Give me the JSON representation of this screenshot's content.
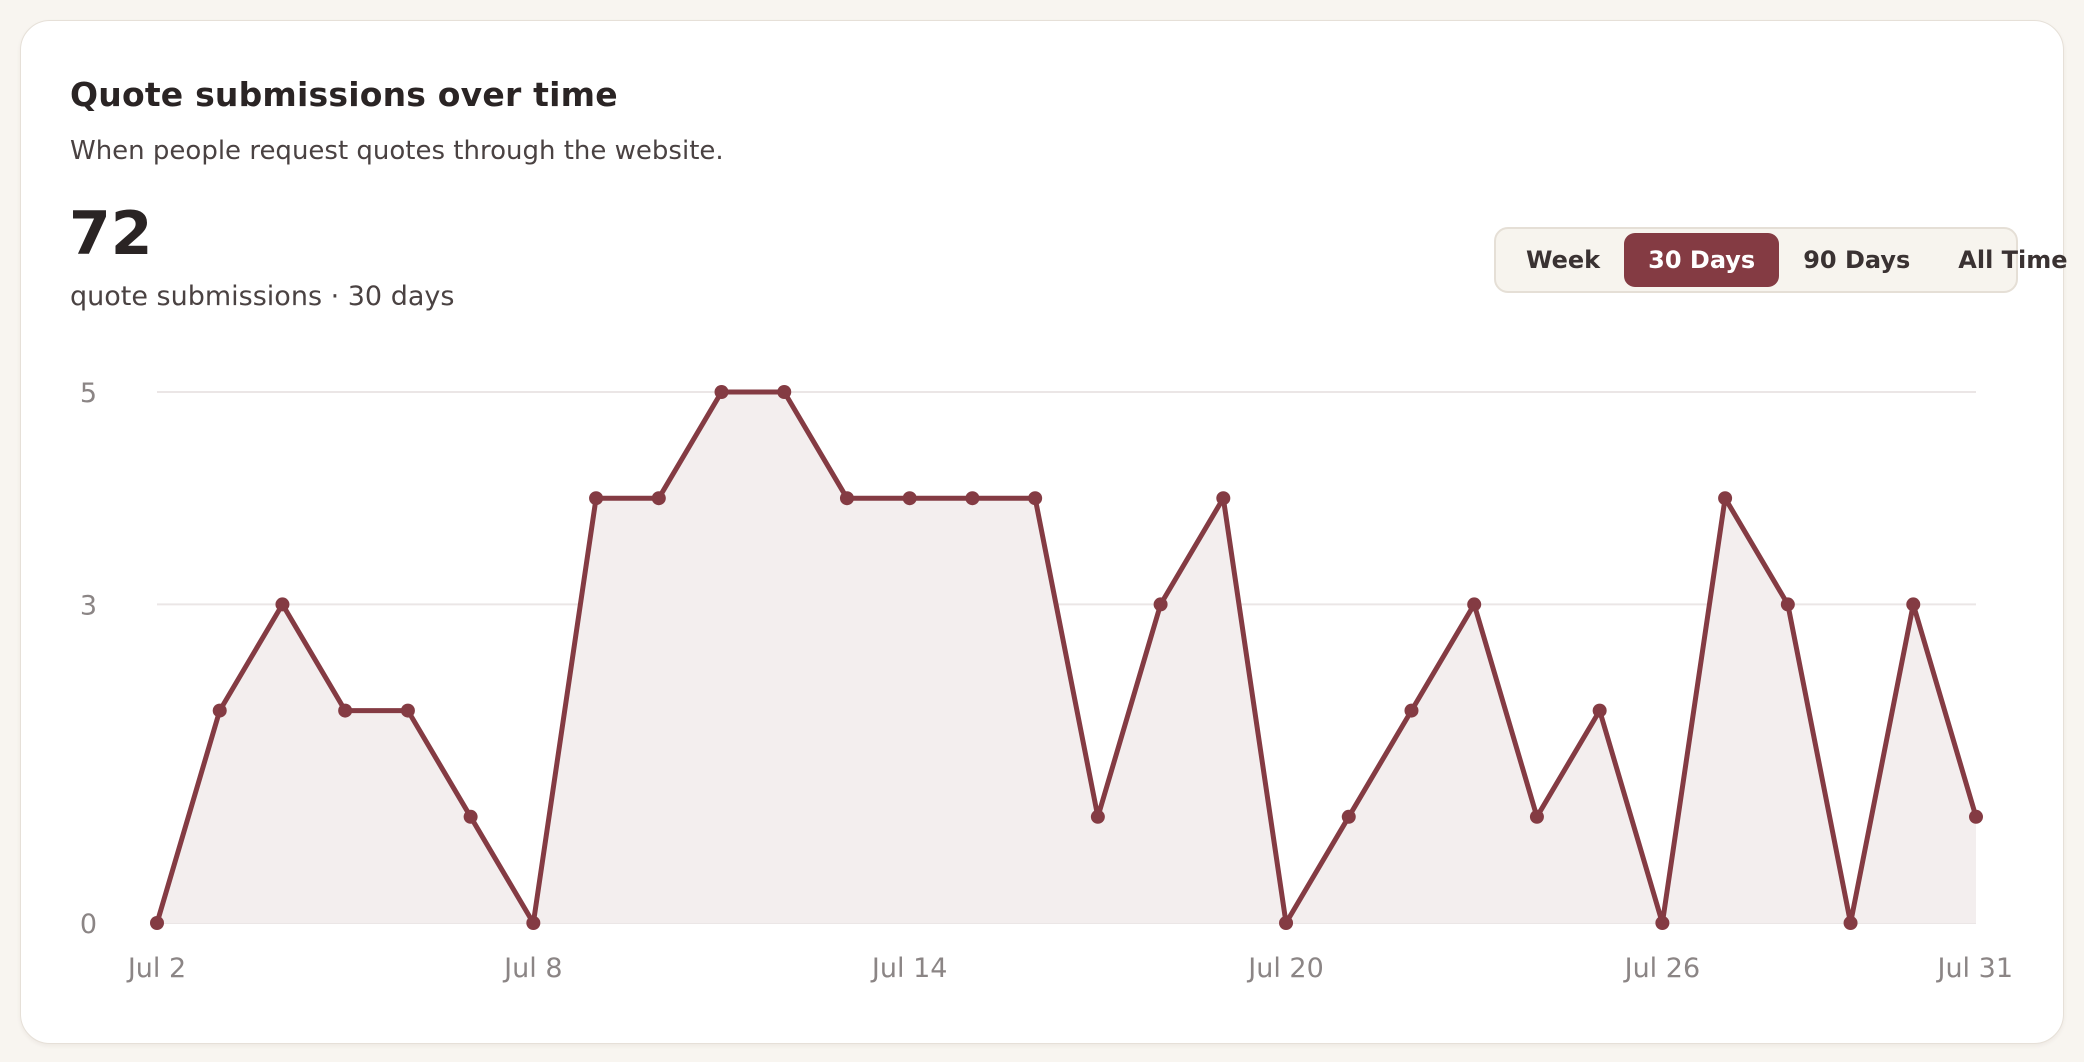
{
  "header": {
    "title": "Quote submissions over time",
    "subtitle": "When people request quotes through the website.",
    "total": "72",
    "total_caption": "quote submissions · 30 days"
  },
  "range": {
    "options": [
      "Week",
      "30 Days",
      "90 Days",
      "All Time"
    ],
    "selected": "30 Days"
  },
  "colors": {
    "accent": "#843b43",
    "area_fill": "#f3eeee",
    "grid": "#ebe6e6",
    "axis_text": "#8b8585"
  },
  "chart_data": {
    "type": "area",
    "x": [
      "Jul 2",
      "Jul 3",
      "Jul 4",
      "Jul 5",
      "Jul 6",
      "Jul 7",
      "Jul 8",
      "Jul 9",
      "Jul 10",
      "Jul 11",
      "Jul 12",
      "Jul 13",
      "Jul 14",
      "Jul 15",
      "Jul 16",
      "Jul 17",
      "Jul 18",
      "Jul 19",
      "Jul 20",
      "Jul 21",
      "Jul 22",
      "Jul 23",
      "Jul 24",
      "Jul 25",
      "Jul 26",
      "Jul 27",
      "Jul 28",
      "Jul 29",
      "Jul 30",
      "Jul 31"
    ],
    "values": [
      0,
      2,
      3,
      2,
      2,
      1,
      0,
      4,
      4,
      5,
      5,
      4,
      4,
      4,
      4,
      1,
      3,
      4,
      0,
      1,
      2,
      3,
      1,
      2,
      0,
      4,
      3,
      0,
      3,
      1
    ],
    "x_ticks": [
      "Jul 2",
      "Jul 8",
      "Jul 14",
      "Jul 20",
      "Jul 26",
      "Jul 31"
    ],
    "y_ticks": [
      0,
      3,
      5
    ],
    "ylim": [
      0,
      5
    ],
    "grid": true,
    "markers": true
  }
}
